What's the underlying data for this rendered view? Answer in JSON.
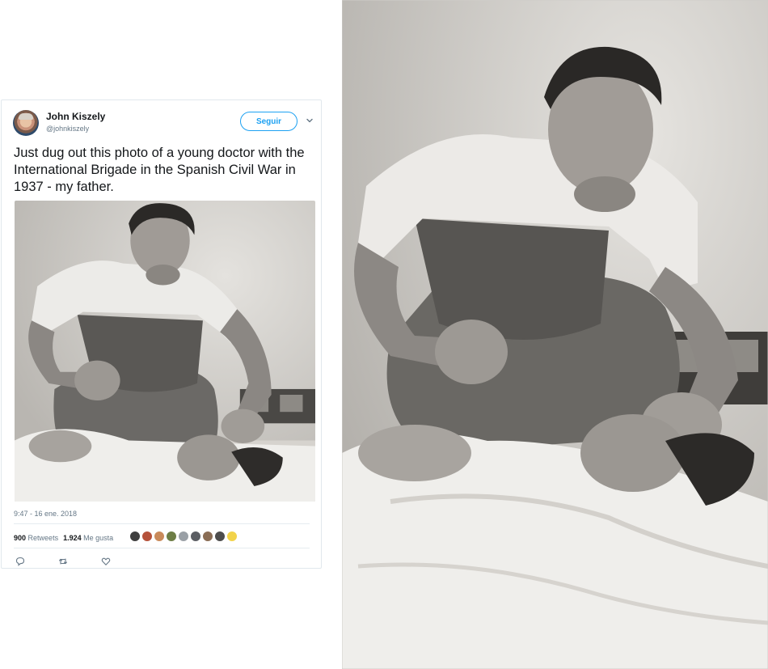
{
  "tweet": {
    "author_name": "John Kiszely",
    "author_handle": "@johnkiszely",
    "follow_label": "Seguir",
    "text": "Just dug out this photo of a young doctor with the International Brigade in the Spanish Civil War in 1937 - my father.",
    "timestamp": "9:47 - 16 ene. 2018",
    "retweets_count": "900",
    "retweets_label": "Retweets",
    "likes_count": "1.924",
    "likes_label": "Me gusta"
  },
  "colors": {
    "accent": "#1da1f2",
    "secondary_text": "#657786",
    "border": "#e1e8ed"
  },
  "icons": [
    "avatar",
    "chevron-down-icon",
    "reply-icon",
    "retweet-icon",
    "heart-icon"
  ]
}
